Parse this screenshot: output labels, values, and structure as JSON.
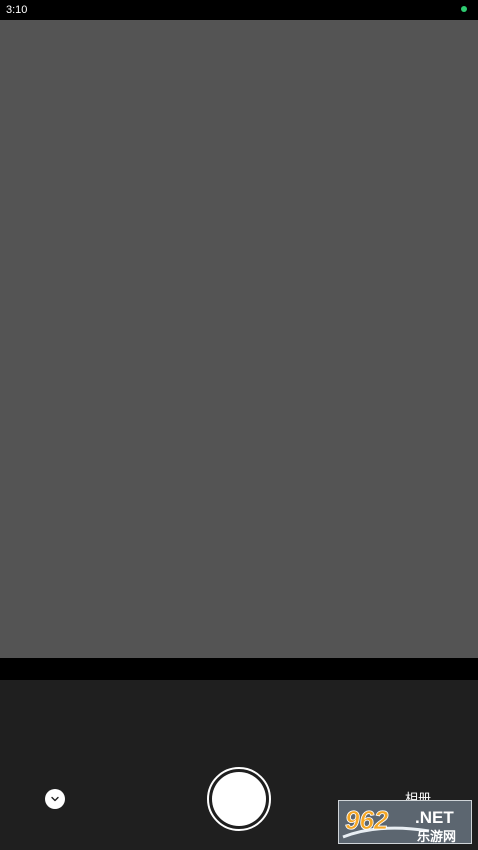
{
  "status_bar": {
    "time": "3:10",
    "indicator_color": "#2ecc71"
  },
  "viewfinder": {
    "color": "#545454"
  },
  "controls": {
    "collapse_icon": "chevron-down-icon",
    "shutter_icon": "shutter-icon",
    "album_label": "相册"
  },
  "watermark": {
    "brand_number": "962",
    "brand_suffix": ".NET",
    "brand_cn": "乐游网"
  }
}
